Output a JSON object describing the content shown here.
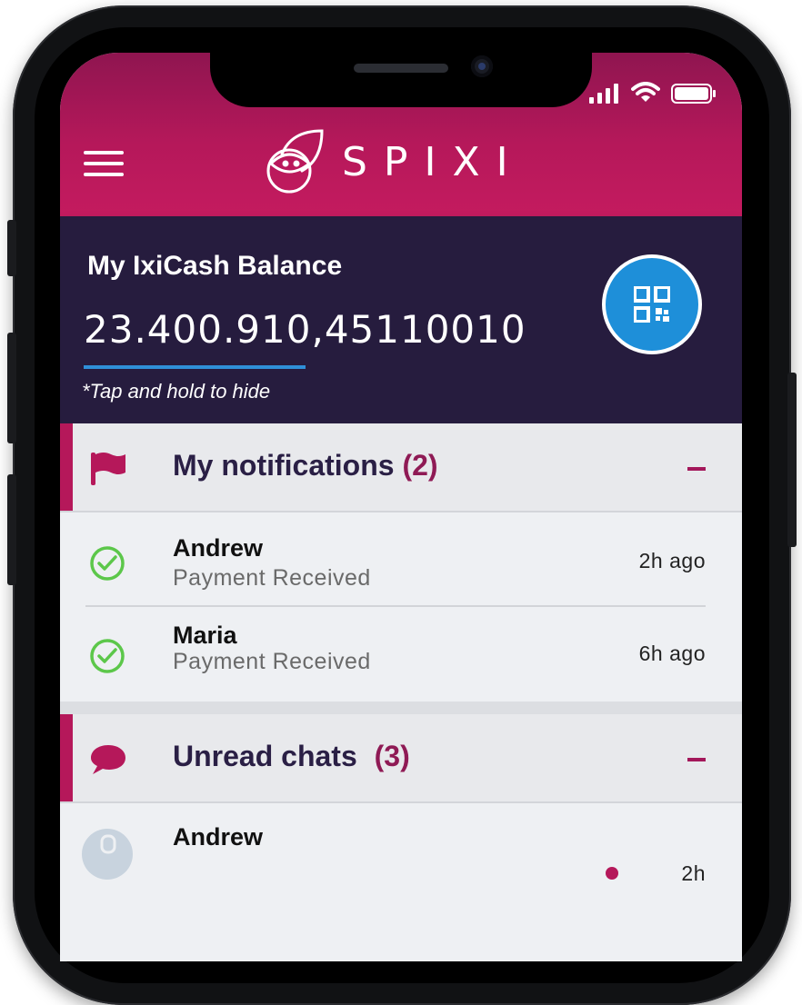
{
  "app": {
    "logo_text": "SPIXI"
  },
  "balance": {
    "title": "My IxiCash Balance",
    "amount": "23.400.910,45110010",
    "hint": "*Tap and hold to hide"
  },
  "notifications": {
    "title": "My notifications",
    "count": "(2)",
    "items": [
      {
        "name": "Andrew",
        "subtitle": "Payment Received",
        "time": "2h ago"
      },
      {
        "name": "Maria",
        "subtitle": "Payment Received",
        "time": "6h ago"
      }
    ]
  },
  "chats": {
    "title": "Unread chats",
    "count": "(3)",
    "items": [
      {
        "name": "Andrew",
        "time": "2h"
      }
    ]
  },
  "colors": {
    "header_top": "#8f1550",
    "header_bottom": "#c41b5f",
    "balance_bg": "#261c3e",
    "accent": "#b5185a",
    "qr_button": "#1e8fd9",
    "check_green": "#5cc74a"
  },
  "icons": {
    "menu": "hamburger-icon",
    "logo": "spixi-logo-icon",
    "qr": "qr-code-icon",
    "notifications": "flag-icon",
    "chats": "chat-bubble-icon",
    "status": "check-circle-icon"
  }
}
